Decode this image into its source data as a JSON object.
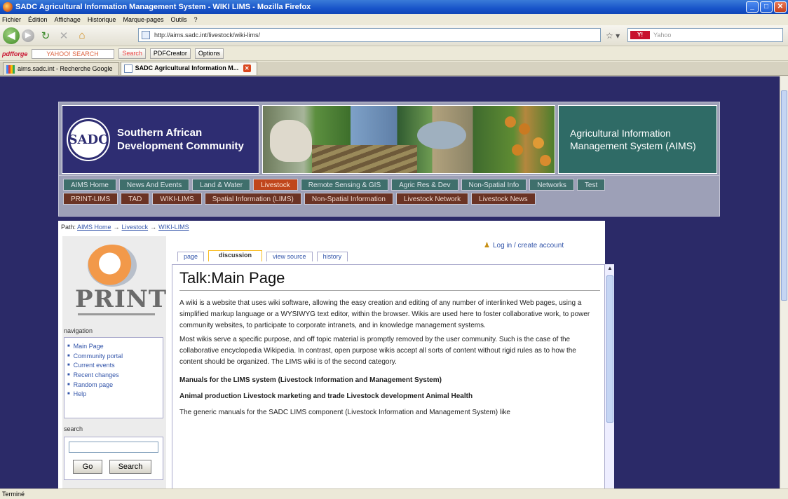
{
  "window": {
    "title": "SADC Agricultural Information Management System - WIKI LIMS - Mozilla Firefox",
    "status": "Terminé"
  },
  "menu": [
    "Fichier",
    "Édition",
    "Affichage",
    "Historique",
    "Marque-pages",
    "Outils",
    "?"
  ],
  "address": {
    "url": "http://aims.sadc.int/livestock/wiki-lims/",
    "search_placeholder": "Yahoo"
  },
  "toolbar": {
    "pdfforge": "pdfforge",
    "yahoo_search_text": "YAHOO! SEARCH",
    "search_btn": "Search",
    "pdfcreator": "PDFCreator",
    "options": "Options"
  },
  "tabs": [
    {
      "label": "aims.sadc.int - Recherche Google",
      "active": false
    },
    {
      "label": "SADC Agricultural Information M...",
      "active": true
    }
  ],
  "header": {
    "sadc_logo_text": "SADC",
    "org_line1": "Southern African",
    "org_line2": "Development Community",
    "aims_line1": "Agricultural Information",
    "aims_line2": "Management System (AIMS)"
  },
  "nav_row1": [
    {
      "label": "AIMS Home",
      "style": "teal"
    },
    {
      "label": "News And Events",
      "style": "teal"
    },
    {
      "label": "Land & Water",
      "style": "teal"
    },
    {
      "label": "Livestock",
      "style": "orange"
    },
    {
      "label": "Remote Sensing & GIS",
      "style": "teal"
    },
    {
      "label": "Agric Res & Dev",
      "style": "teal"
    },
    {
      "label": "Non-Spatial Info",
      "style": "teal"
    },
    {
      "label": "Networks",
      "style": "teal"
    },
    {
      "label": "Test",
      "style": "teal"
    }
  ],
  "nav_row2": [
    {
      "label": "PRINT-LIMS",
      "style": "brown"
    },
    {
      "label": "TAD",
      "style": "brown"
    },
    {
      "label": "WIKI-LIMS",
      "style": "brown"
    },
    {
      "label": "Spatial Information (LIMS)",
      "style": "brown"
    },
    {
      "label": "Non-Spatial Information",
      "style": "brown"
    },
    {
      "label": "Livestock Network",
      "style": "brown"
    },
    {
      "label": "Livestock News",
      "style": "brown"
    }
  ],
  "breadcrumb": {
    "prefix": "Path:",
    "items": [
      "AIMS Home",
      "Livestock",
      "WIKI-LIMS"
    ]
  },
  "sidebar": {
    "logo_text": "PRINT",
    "nav_title": "navigation",
    "nav_items": [
      "Main Page",
      "Community portal",
      "Current events",
      "Recent changes",
      "Random page",
      "Help"
    ],
    "search_title": "search",
    "go_label": "Go",
    "search_label": "Search"
  },
  "wiki": {
    "login": "Log in / create account",
    "tabs": [
      "page",
      "discussion",
      "view source",
      "history"
    ],
    "title": "Talk:Main Page",
    "p1": "A wiki is a website that uses wiki software, allowing the easy creation and editing of any number of interlinked Web pages, using a simplified markup language or a WYSIWYG text editor, within the browser. Wikis are used here to foster collaborative work, to power community websites, to participate to corporate intranets, and in knowledge management systems.",
    "p2": "Most wikis serve a specific purpose, and off topic material is promptly removed by the user community. Such is the case of the collaborative encyclopedia Wikipedia. In contrast, open purpose wikis accept all sorts of content without rigid rules as to how the content should be organized. The LIMS wiki is of the second category.",
    "h1": "Manuals for the LIMS system (Livestock Information and Management System)",
    "h2": "Animal production Livestock marketing and trade Livestock development Animal Health",
    "p3": "The generic manuals for the SADC LIMS component (Livestock Information and Management System) like"
  }
}
